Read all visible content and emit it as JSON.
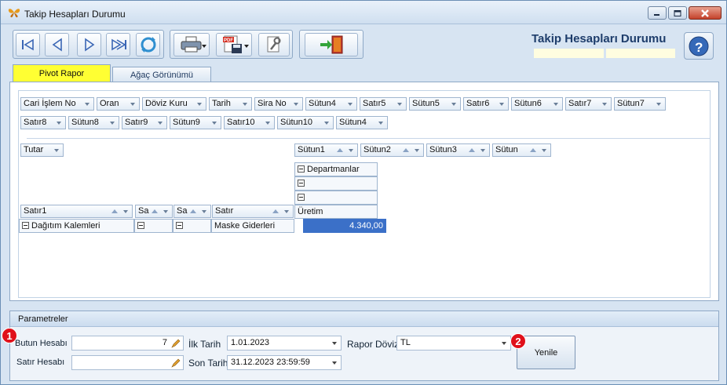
{
  "window": {
    "title": "Takip Hesapları Durumu",
    "app_title": "Takip Hesapları Durumu"
  },
  "icons": {
    "app": "butterfly-icon",
    "minimize": "minimize-icon",
    "maximize": "maximize-icon",
    "close": "close-icon",
    "first": "first-record-icon",
    "prev": "previous-icon",
    "next": "next-icon",
    "last": "last-record-icon",
    "refresh": "refresh-icon",
    "print": "printer-icon",
    "pdf": "pdf-save-icon",
    "tools": "tools-icon",
    "exit": "exit-door-icon",
    "help": "help-icon",
    "lookup": "lookup-pencil-icon"
  },
  "tabs": {
    "pivot": "Pivot Rapor",
    "tree": "Ağaç Görünümü"
  },
  "pivot": {
    "filter_row1": [
      "Cari İşlem No",
      "Oran",
      "Döviz Kuru",
      "Tarih",
      "Sira No",
      "Sütun4",
      "Satır5",
      "Sütun5",
      "Satır6",
      "Sütun6",
      "Satır7",
      "Sütun7"
    ],
    "filter_row2": [
      "Satır8",
      "Sütun8",
      "Satır9",
      "Sütun9",
      "Satır10",
      "Sütun10",
      "Sütun4"
    ],
    "data_field": "Tutar",
    "column_fields": [
      "Sütun1",
      "Sütun2",
      "Sütun3",
      "Sütun"
    ],
    "col_header_top": "Departmanlar",
    "col_header_leaf": "Üretim",
    "row_fields": [
      "Satır1",
      "Sa",
      "Sa",
      "Satır"
    ],
    "row_values": [
      "Dağıtım Kalemleri",
      "",
      "",
      "Maske Giderleri"
    ],
    "value": "4.340,00"
  },
  "params": {
    "header": "Parametreler",
    "butun_label": "Butun Hesabı",
    "butun_value": "7",
    "satir_label": "Satır Hesabı",
    "satir_value": "",
    "ilk_label": "İlk Tarih",
    "ilk_value": "1.01.2023",
    "son_label": "Son Tarih",
    "son_value": "31.12.2023 23:59:59",
    "doviz_label": "Rapor Dövizi",
    "doviz_value": "TL",
    "refresh_label": "Yenile"
  },
  "badges": [
    "1",
    "2"
  ],
  "colors": {
    "active_tab": "#ffff33",
    "selected_cell": "#3b70c8",
    "badge": "#e0101a"
  }
}
